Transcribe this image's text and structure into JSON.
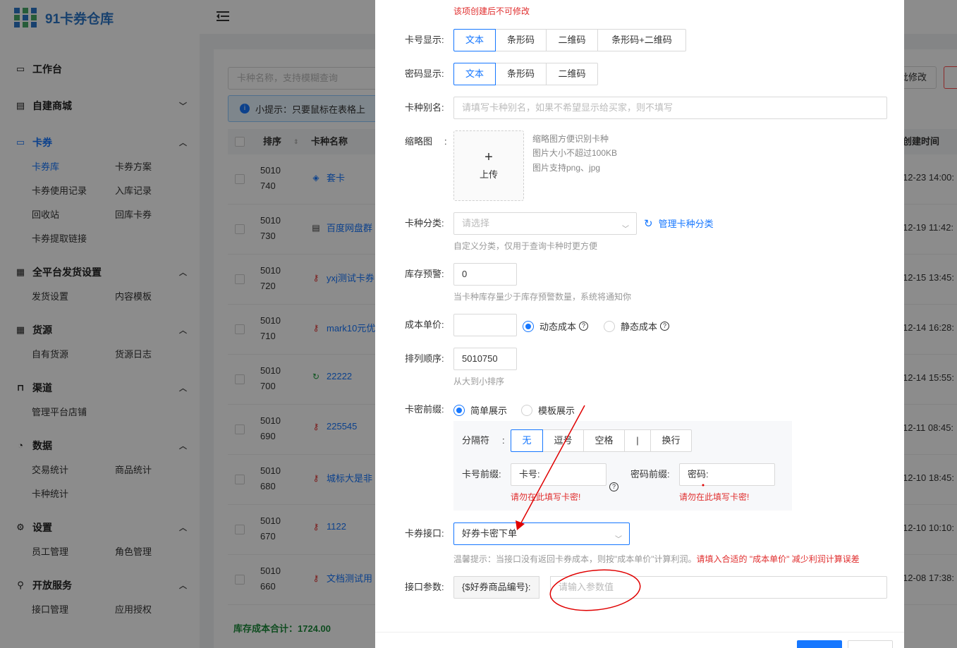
{
  "brand": {
    "name": "91卡券仓库"
  },
  "sidebar": {
    "groups": [
      {
        "label": "工作台",
        "icon": "monitor-icon",
        "items": []
      },
      {
        "label": "自建商城",
        "icon": "shop-icon",
        "items": []
      },
      {
        "label": "卡券",
        "icon": "card-icon",
        "items": [
          "卡券库",
          "卡券方案",
          "卡券使用记录",
          "入库记录",
          "回收站",
          "回库卡券",
          "卡券提取链接"
        ]
      },
      {
        "label": "全平台发货设置",
        "icon": "grid-icon",
        "items": [
          "发货设置",
          "内容模板"
        ]
      },
      {
        "label": "货源",
        "icon": "grid-icon",
        "items": [
          "自有货源",
          "货源日志"
        ]
      },
      {
        "label": "渠道",
        "icon": "bag-icon",
        "items": [
          "管理平台店铺"
        ]
      },
      {
        "label": "数据",
        "icon": "pie-icon",
        "items": [
          "交易统计",
          "商品统计",
          "卡种统计"
        ]
      },
      {
        "label": "设置",
        "icon": "gear-icon",
        "items": [
          "员工管理",
          "角色管理"
        ]
      },
      {
        "label": "开放服务",
        "icon": "link-icon",
        "items": [
          "接口管理",
          "应用授权"
        ]
      }
    ]
  },
  "list": {
    "search_placeholder": "卡种名称，支持模糊查询",
    "tip": "小提示：只要鼠标在表格上",
    "batch_edit_label": "批修改",
    "headers": {
      "seq": "排序",
      "name": "卡种名称",
      "created": "创建时间"
    },
    "rows": [
      {
        "seq": "5010740",
        "name": "套卡",
        "icon": "stack-icon",
        "created": "12-23 14:00:"
      },
      {
        "seq": "5010730",
        "name": "百度网盘群",
        "icon": "document-icon",
        "created": "12-19 11:42:"
      },
      {
        "seq": "5010720",
        "name": "yxj测试卡券",
        "icon": "key-icon",
        "created": "12-15 13:45:"
      },
      {
        "seq": "5010710",
        "name": "mark10元优",
        "icon": "key-icon",
        "created": "12-14 16:28:"
      },
      {
        "seq": "5010700",
        "name": "22222",
        "icon": "refresh-icon",
        "created": "12-14 15:55:"
      },
      {
        "seq": "5010690",
        "name": "225545",
        "icon": "key-icon",
        "created": "12-11 08:45:"
      },
      {
        "seq": "5010680",
        "name": "城标大是非",
        "icon": "key-icon",
        "created": "12-10 18:45:"
      },
      {
        "seq": "5010670",
        "name": "1122",
        "icon": "key-icon",
        "created": "12-10 10:10:"
      },
      {
        "seq": "5010660",
        "name": "文档测试用",
        "icon": "key-icon",
        "created": "12-08 17:38:"
      }
    ],
    "cost_total": "库存成本合计：1724.00"
  },
  "form": {
    "top_note": "该项创建后不可修改",
    "card_display": {
      "label": "卡号显示:",
      "options": [
        "文本",
        "条形码",
        "二维码",
        "条形码+二维码"
      ],
      "selected": 0
    },
    "pwd_display": {
      "label": "密码显示:",
      "options": [
        "文本",
        "条形码",
        "二维码"
      ],
      "selected": 0
    },
    "alias": {
      "label": "卡种别名:",
      "placeholder": "请填写卡种别名，如果不希望显示给买家，则不填写"
    },
    "thumb": {
      "label": "缩略图",
      "colon": ":",
      "plus": "+",
      "upload": "上传",
      "notes": [
        "缩略图方便识别卡种",
        "图片大小不超过100KB",
        "图片支持png、jpg"
      ]
    },
    "category": {
      "label": "卡种分类:",
      "placeholder": "请选择",
      "manage": "管理卡种分类",
      "hint": "自定义分类，仅用于查询卡种时更方便"
    },
    "stock_warn": {
      "label": "库存预警:",
      "value": "0",
      "hint": "当卡种库存量少于库存预警数量，系统将通知你"
    },
    "unit_cost": {
      "label": "成本单价:",
      "value": "",
      "options": [
        "动态成本",
        "静态成本"
      ],
      "selected": 0
    },
    "sort_order": {
      "label": "排列顺序:",
      "value": "5010750",
      "hint": "从大到小排序"
    },
    "prefix": {
      "label": "卡密前缀:",
      "options": [
        "简单展示",
        "模板展示"
      ],
      "selected": 0,
      "separator_label": "分隔符",
      "separator_colon": ":",
      "separators": [
        "无",
        "逗号",
        "空格",
        "|",
        "换行"
      ],
      "separator_selected": 0,
      "card_prefix_label": "卡号前缀:",
      "card_prefix_value": "卡号:",
      "pwd_prefix_label": "密码前缀:",
      "pwd_prefix_value": "密码:",
      "warn": "请勿在此填写卡密!"
    },
    "api": {
      "label": "卡券接口:",
      "value": "好券卡密下单",
      "hint": "温馨提示：当接口没有返回卡券成本，则按\"成本单价\"计算利润。",
      "hint_red": "请填入合适的 \"成本单价\" 减少利润计算误差"
    },
    "api_param": {
      "label": "接口参数:",
      "addon": "{$好券商品编号}:",
      "placeholder": "请输入参数值"
    }
  },
  "colors": {
    "accent": "#1677ff",
    "error": "#e02e2e",
    "annotation": "#e00000"
  }
}
